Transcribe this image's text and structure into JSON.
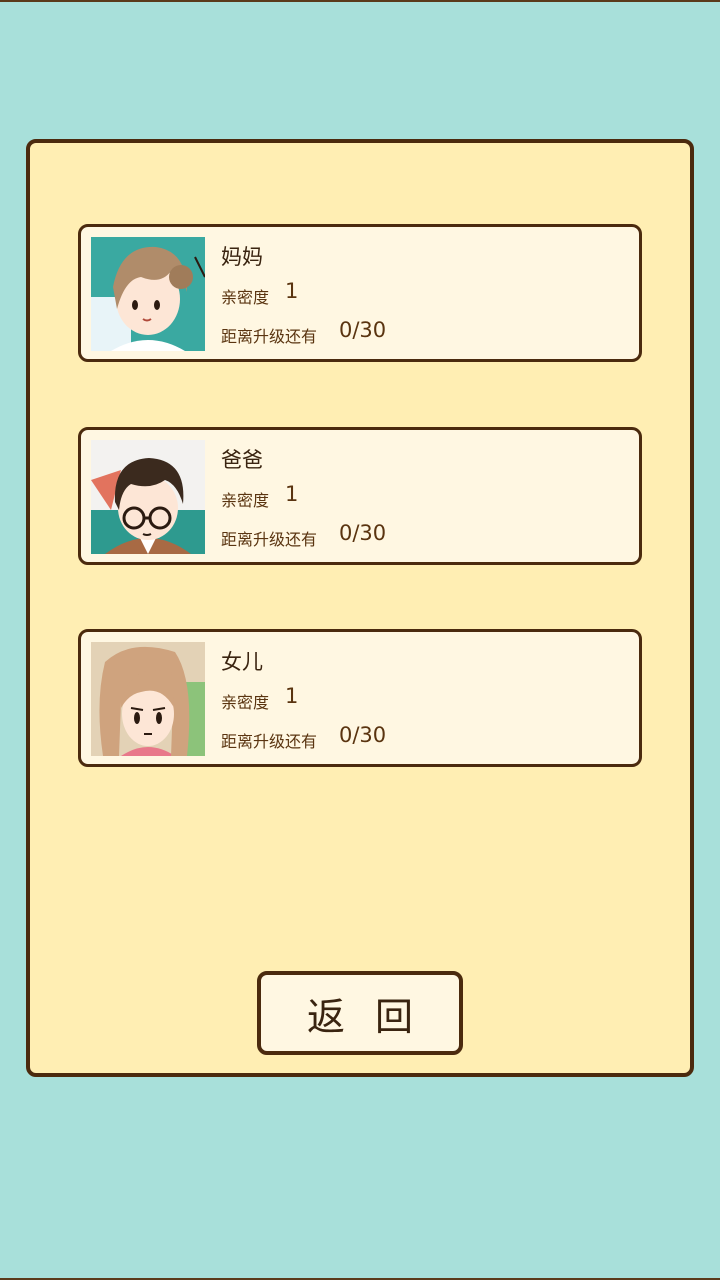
{
  "characters": [
    {
      "name": "妈妈",
      "affinity_label": "亲密度",
      "affinity_value": "1",
      "levelup_label": "距离升级还有",
      "progress": "0/30",
      "avatar_icon": "mom-portrait-icon"
    },
    {
      "name": "爸爸",
      "affinity_label": "亲密度",
      "affinity_value": "1",
      "levelup_label": "距离升级还有",
      "progress": "0/30",
      "avatar_icon": "dad-portrait-icon"
    },
    {
      "name": "女儿",
      "affinity_label": "亲密度",
      "affinity_value": "1",
      "levelup_label": "距离升级还有",
      "progress": "0/30",
      "avatar_icon": "daughter-portrait-icon"
    }
  ],
  "back_button": {
    "label": "返回"
  },
  "colors": {
    "background": "#a8e0da",
    "panel": "#ffeeb3",
    "card": "#fff7e2",
    "border": "#4b2a0e"
  }
}
